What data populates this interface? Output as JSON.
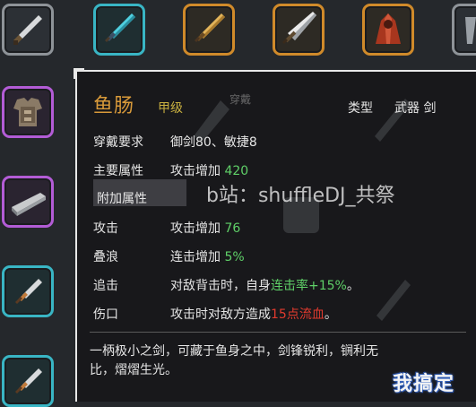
{
  "inventory": {
    "top_row": [
      {
        "icon": "dagger-icon",
        "rarity": "gray"
      },
      {
        "icon": "teal-sword-icon",
        "rarity": "teal"
      },
      {
        "icon": "golden-sword-icon",
        "rarity": "gold"
      },
      {
        "icon": "broad-sword-icon",
        "rarity": "gold"
      },
      {
        "icon": "red-cloak-icon",
        "rarity": "gold"
      },
      {
        "icon": "partial-item-icon",
        "rarity": "gray"
      }
    ],
    "left_column": [
      {
        "icon": "chest-armor-icon",
        "rarity": "purple"
      },
      {
        "icon": "iron-ingot-icon",
        "rarity": "purple"
      },
      {
        "icon": "fish-intestine-sword-icon",
        "rarity": "teal"
      },
      {
        "icon": "short-sword-icon",
        "rarity": "teal"
      }
    ]
  },
  "tooltip": {
    "name": "鱼肠",
    "grade": "甲级",
    "type_label": "类型",
    "type_value": "武器 剑",
    "stats": [
      {
        "label": "穿戴要求",
        "value": "御剑80、敏捷8",
        "highlight": "",
        "tail": ""
      },
      {
        "label": "主要属性",
        "value": "攻击增加 ",
        "highlight": "420",
        "tail": ""
      },
      {
        "label": "附加属性",
        "value": "",
        "highlight": "",
        "tail": ""
      },
      {
        "label": "攻击",
        "value": "攻击增加 ",
        "highlight": "76",
        "tail": ""
      },
      {
        "label": "叠浪",
        "value": "连击增加 ",
        "highlight": "5%",
        "tail": ""
      },
      {
        "label": "追击",
        "value": "对敌背击时，自身",
        "highlight": "连击率+15%",
        "tail": "。"
      },
      {
        "label": "伤口",
        "value": "攻击时对敌方造成",
        "highlight": "15点流血",
        "tail": "。"
      }
    ],
    "description": "一柄极小之剑，可藏于鱼身之中，剑锋锐利，锎利无比，熠熠生光。",
    "ghost_text": "穿戴"
  },
  "overlay": {
    "watermark": "b站：shuffleDJ_共祭",
    "site_logo": "我搞定"
  },
  "colors": {
    "title": "#d99a3a",
    "grade": "#c9b040",
    "highlight_green": "#5fd068",
    "highlight_red": "#e03a2e",
    "rarity_gold": "#d08a2a",
    "rarity_purple": "#b35cd6",
    "rarity_teal": "#39b5c4",
    "rarity_gray": "#8e9398"
  }
}
